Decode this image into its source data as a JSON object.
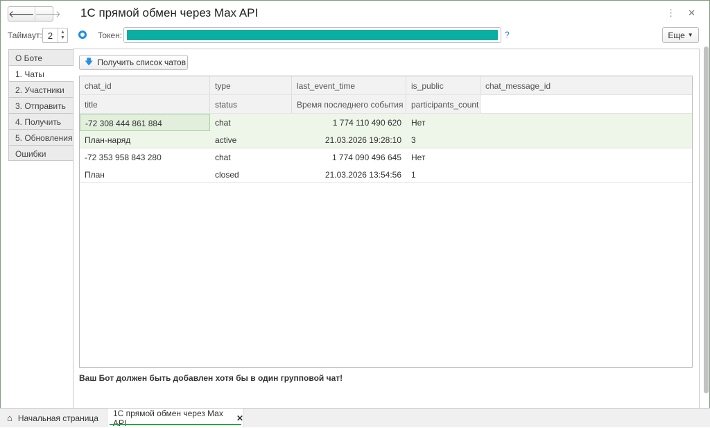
{
  "window": {
    "title": "1С прямой обмен через Max API",
    "more_label": "Еще"
  },
  "settings": {
    "timeout_label": "Таймаут:",
    "timeout_value": "2",
    "token_label": "Токен:",
    "help": "?"
  },
  "tabs": [
    "О Боте",
    "1. Чаты",
    "2. Участники",
    "3. Отправить",
    "4. Получить",
    "5. Обновления",
    "Ошибки"
  ],
  "get_chats_label": "Получить список чатов",
  "table": {
    "headers1": [
      "chat_id",
      "type",
      "last_event_time",
      "is_public",
      "chat_message_id"
    ],
    "headers2": [
      "title",
      "status",
      "Время последнего события",
      "participants_count"
    ],
    "rows": [
      {
        "chat_id": "-72 308 444 861 884",
        "type": "chat",
        "last_event_time": "1 774 110 490 620",
        "is_public": "Нет",
        "title": "План-наряд",
        "status": "active",
        "time": "21.03.2026 19:28:10",
        "participants": "3"
      },
      {
        "chat_id": "-72 353 958 843 280",
        "type": "chat",
        "last_event_time": "1 774 090 496 645",
        "is_public": "Нет",
        "title": "План",
        "status": "closed",
        "time": "21.03.2026 13:54:56",
        "participants": "1"
      }
    ]
  },
  "note": "Ваш Бот должен быть добавлен хотя бы в один групповой чат!",
  "bottom_tabs": {
    "home": "Начальная страница",
    "current": "1С прямой обмен через Max API"
  }
}
